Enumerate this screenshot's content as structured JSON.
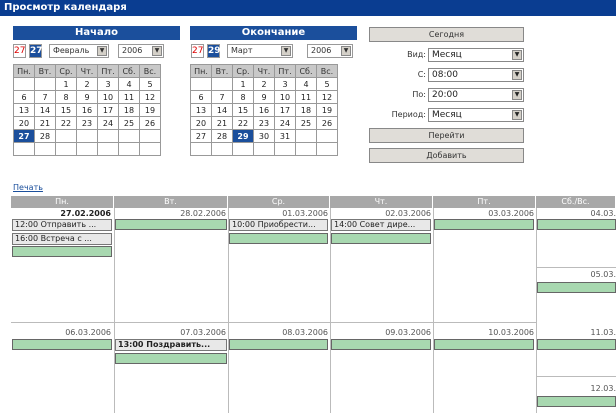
{
  "title": "Просмотр календаря",
  "start": {
    "header": "Начало",
    "day_prev": "27",
    "day_sel": "27",
    "month": "Февраль",
    "year": "2006",
    "weekdays": [
      "Пн.",
      "Вт.",
      "Ср.",
      "Чт.",
      "Пт.",
      "Сб.",
      "Вс."
    ],
    "rows": [
      [
        "",
        "",
        "1",
        "2",
        "3",
        "4",
        "5"
      ],
      [
        "6",
        "7",
        "8",
        "9",
        "10",
        "11",
        "12"
      ],
      [
        "13",
        "14",
        "15",
        "16",
        "17",
        "18",
        "19"
      ],
      [
        "20",
        "21",
        "22",
        "23",
        "24",
        "25",
        "26"
      ],
      [
        "27",
        "28",
        "",
        "",
        "",
        "",
        ""
      ],
      [
        "",
        "",
        "",
        "",
        "",
        "",
        ""
      ]
    ]
  },
  "end": {
    "header": "Окончание",
    "day_prev": "27",
    "day_sel": "29",
    "month": "Март",
    "year": "2006",
    "weekdays": [
      "Пн.",
      "Вт.",
      "Ср.",
      "Чт.",
      "Пт.",
      "Сб.",
      "Вс."
    ],
    "rows": [
      [
        "",
        "",
        "1",
        "2",
        "3",
        "4",
        "5"
      ],
      [
        "6",
        "7",
        "8",
        "9",
        "10",
        "11",
        "12"
      ],
      [
        "13",
        "14",
        "15",
        "16",
        "17",
        "18",
        "19"
      ],
      [
        "20",
        "21",
        "22",
        "23",
        "24",
        "25",
        "26"
      ],
      [
        "27",
        "28",
        "29",
        "30",
        "31",
        "",
        ""
      ],
      [
        "",
        "",
        "",
        "",
        "",
        "",
        ""
      ]
    ]
  },
  "controls": {
    "today": "Сегодня",
    "view_label": "Вид:",
    "view_value": "Месяц",
    "from_label": "С:",
    "from_value": "08:00",
    "to_label": "По:",
    "to_value": "20:00",
    "period_label": "Период:",
    "period_value": "Месяц",
    "go": "Перейти",
    "add": "Добавить"
  },
  "print": "Печать",
  "week_headers": [
    "Пн.",
    "Вт.",
    "Ср.",
    "Чт.",
    "Пт.",
    "Сб./Вс."
  ],
  "week1": {
    "dates": [
      "27.02.2006",
      "28.02.2006",
      "01.03.2006",
      "02.03.2006",
      "03.03.2006",
      "04.03.",
      "05.03."
    ],
    "events": {
      "mon1": "12:00  Отправить ...",
      "mon2": "16:00  Встреча с ...",
      "wed": "10:00  Приобрести...",
      "thu": "14:00  Совет дире..."
    }
  },
  "week2": {
    "dates": [
      "06.03.2006",
      "07.03.2006",
      "08.03.2006",
      "09.03.2006",
      "10.03.2006",
      "11.03.",
      "12.03."
    ],
    "events": {
      "tue": "13:00  Поздравить..."
    }
  }
}
